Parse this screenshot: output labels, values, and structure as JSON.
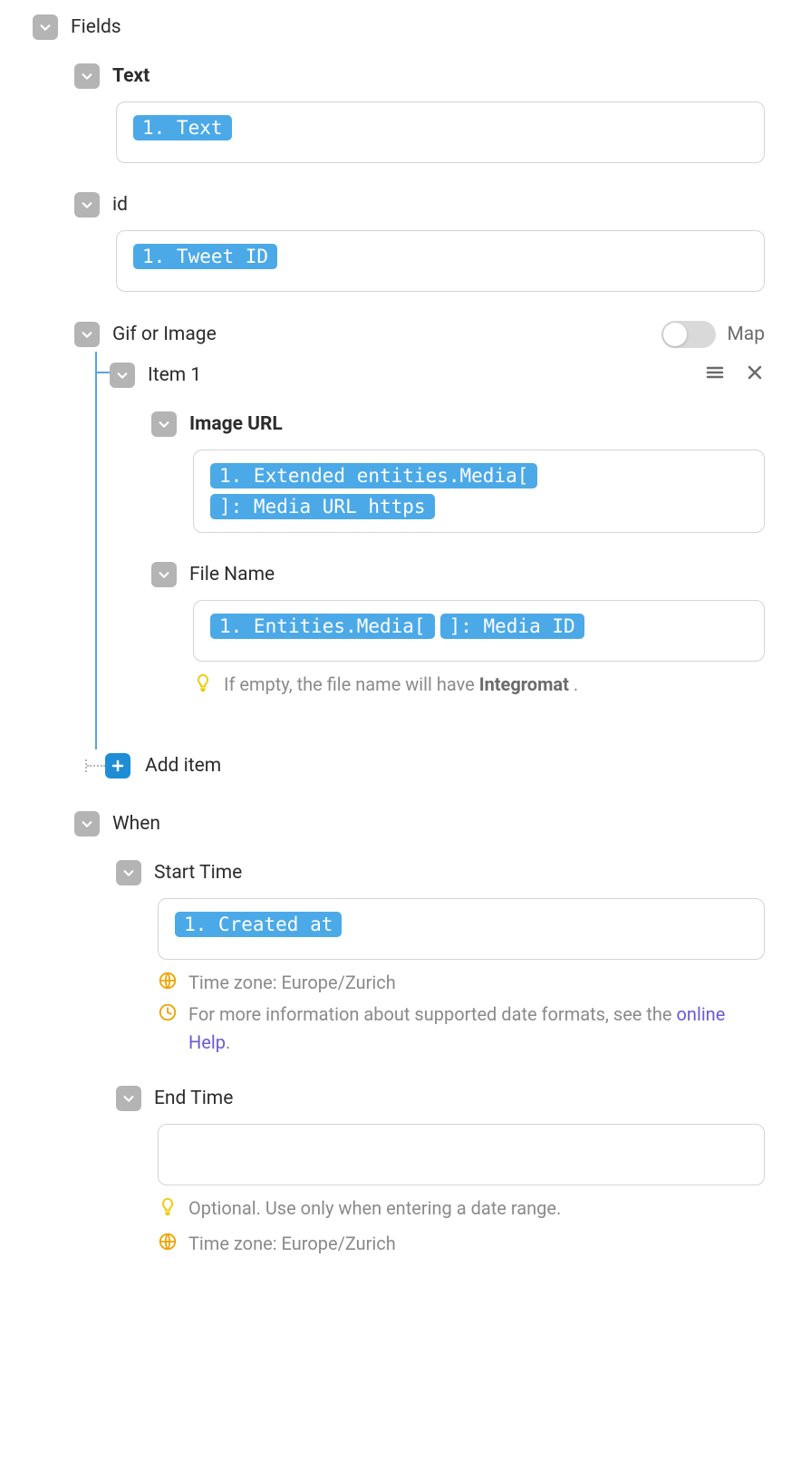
{
  "fields": {
    "label": "Fields",
    "text": {
      "label": "Text",
      "pill": "1. Text"
    },
    "id": {
      "label": "id",
      "pill": "1. Tweet ID"
    },
    "gif_or_image": {
      "label": "Gif or Image",
      "map_label": "Map",
      "item1": {
        "label": "Item 1",
        "image_url": {
          "label": "Image URL",
          "pill1": "1. Extended entities.Media[",
          "pill2": "]: Media URL https"
        },
        "file_name": {
          "label": "File Name",
          "pill1": "1. Entities.Media[",
          "pill2": "]: Media ID",
          "hint_prefix": "If empty, the file name will have ",
          "hint_strong": "Integromat",
          "hint_suffix": " ."
        }
      },
      "add_item": "Add item"
    },
    "when": {
      "label": "When",
      "start_time": {
        "label": "Start Time",
        "pill": "1. Created at",
        "tz_label": "Time zone: Europe/Zurich",
        "info_prefix": "For more information about supported date formats, see the ",
        "info_link": "online Help",
        "info_suffix": "."
      },
      "end_time": {
        "label": "End Time",
        "hint": "Optional. Use only when entering a date range.",
        "tz_label": "Time zone: Europe/Zurich"
      }
    }
  }
}
